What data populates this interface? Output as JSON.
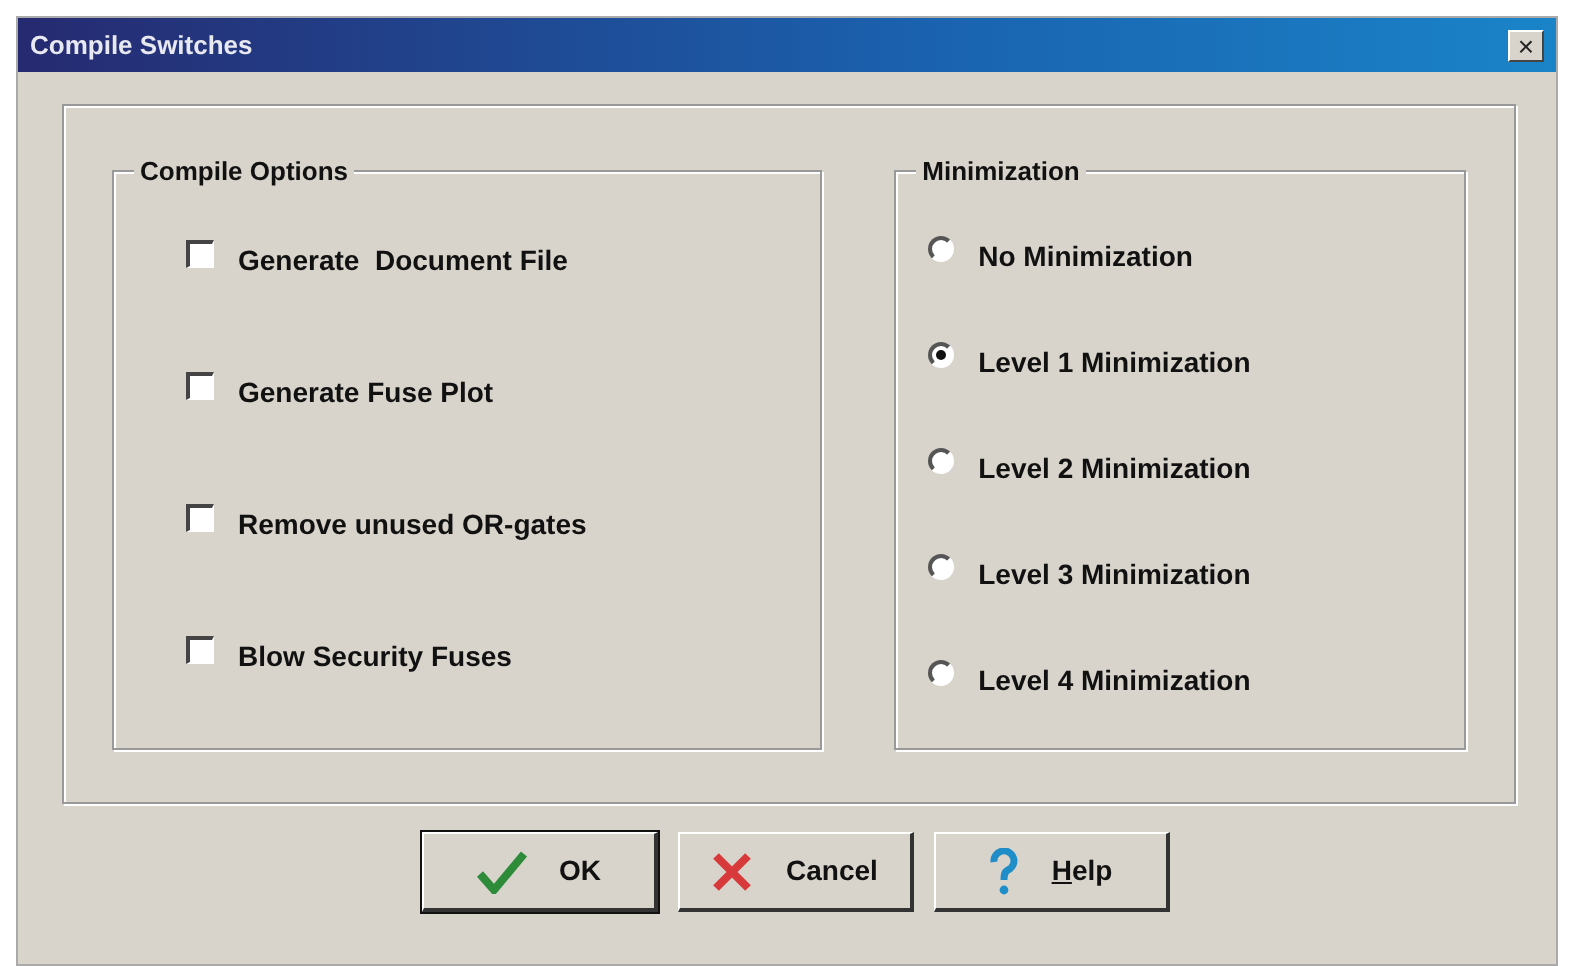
{
  "window": {
    "title": "Compile Switches",
    "close": "×"
  },
  "compile_options": {
    "title": "Compile Options",
    "items": [
      {
        "label": "Generate  Document File",
        "checked": false
      },
      {
        "label": "Generate Fuse Plot",
        "checked": false
      },
      {
        "label": "Remove unused OR-gates",
        "checked": false
      },
      {
        "label": "Blow Security Fuses",
        "checked": false
      }
    ]
  },
  "minimization": {
    "title": "Minimization",
    "items": [
      {
        "label": "No Minimization",
        "selected": false
      },
      {
        "label": "Level 1 Minimization",
        "selected": true
      },
      {
        "label": "Level 2 Minimization",
        "selected": false
      },
      {
        "label": "Level 3 Minimization",
        "selected": false
      },
      {
        "label": "Level 4 Minimization",
        "selected": false
      }
    ]
  },
  "buttons": [
    {
      "label": "OK",
      "kind": "ok",
      "default": true
    },
    {
      "label": "Cancel",
      "kind": "cancel",
      "default": false
    },
    {
      "label": "Help",
      "kind": "help",
      "default": false,
      "first_letter_underlined": true
    }
  ]
}
